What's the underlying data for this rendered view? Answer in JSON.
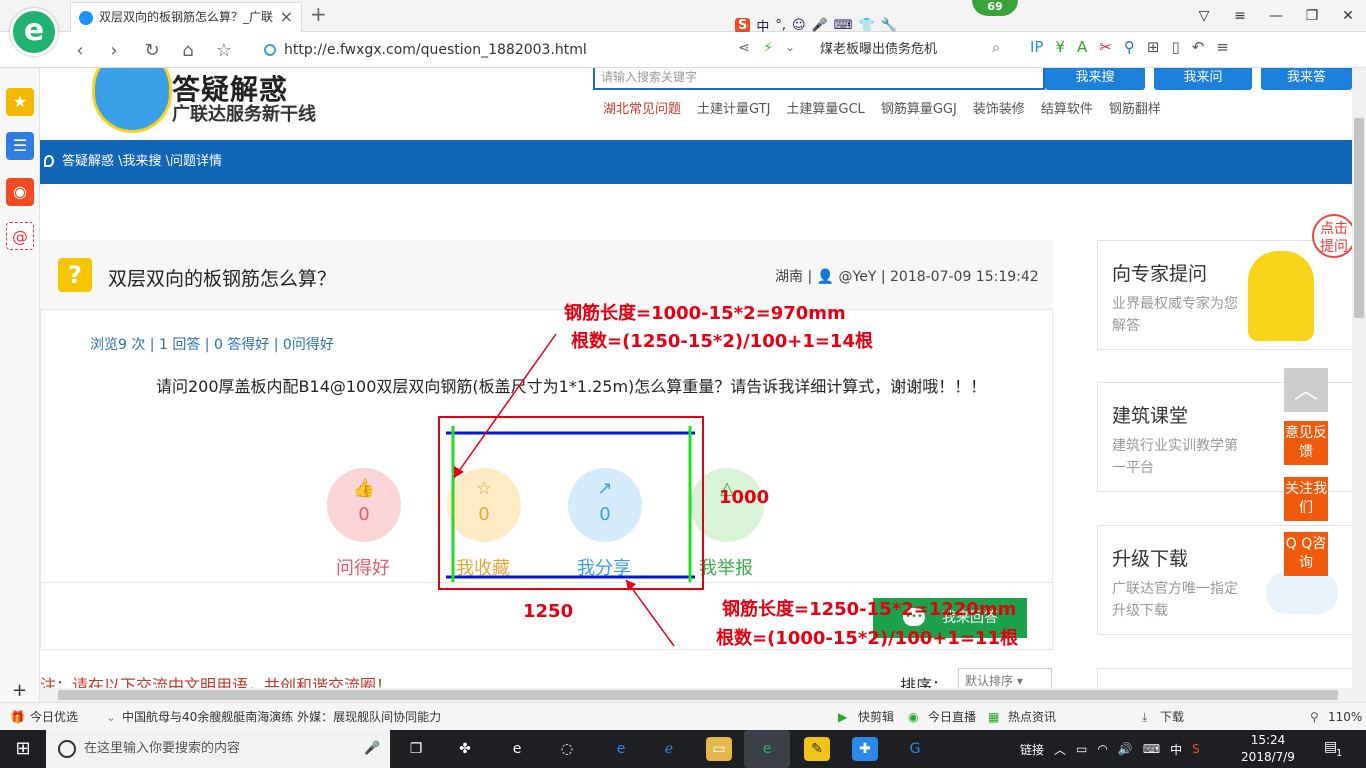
{
  "browser": {
    "logo_glyph": "e",
    "tab_title": "双层双向的板钢筋怎么算？_广联",
    "tab_close": "×",
    "new_tab": "+",
    "url": "http://e.fwxgx.com/question_1882003.html",
    "news_search": "煤老板曝出债务危机",
    "ime_label": "中",
    "ime_logo": "S",
    "badge": "69"
  },
  "sidebar": {
    "add": "+"
  },
  "site": {
    "title": "答疑解惑",
    "slogan": "广联达服务新干线",
    "search_placeholder": "请输入搜索关键字",
    "btn_search": "我来搜",
    "btn_ask": "我来问",
    "btn_answer": "我来答",
    "categories": [
      "湖北常见问题",
      "土建计量GTJ",
      "土建算量GCL",
      "钢筋算量GGJ",
      "装饰装修",
      "结算软件",
      "钢筋翻样"
    ]
  },
  "breadcrumb": "答疑解惑 \\我来搜 \\问题详情",
  "question": {
    "icon": "?",
    "title": "双层双向的板钢筋怎么算？",
    "meta_region": "湖南",
    "meta_user": "@YeY",
    "meta_time": "2018-07-09 15:19:42",
    "stats": "浏览9 次 | 1 回答 | 0 答得好 | 0问得好",
    "body": "请问200厚盖板内配B14@100双层双向钢筋(板盖尺寸为1*1.25m)怎么算重量？请告诉我详细计算式，谢谢哦！！！"
  },
  "actions": [
    {
      "label": "问得好",
      "count": "0",
      "glyph": "👍"
    },
    {
      "label": "我收藏",
      "count": "0",
      "glyph": "☆"
    },
    {
      "label": "我分享",
      "count": "0",
      "glyph": "↗"
    },
    {
      "label": "我举报",
      "count": "",
      "glyph": "△"
    }
  ],
  "answer_button": "我来回答",
  "notice": "注：请在以下交流中文明用语，共创和谐交流圈！",
  "sort": {
    "label": "排序：",
    "value": "默认排序"
  },
  "right_cards": [
    {
      "title": "向专家提问",
      "desc": "业界最权威专家为您解答"
    },
    {
      "title": "建筑课堂",
      "desc": "建筑行业实训教学第一平台"
    },
    {
      "title": "升级下载",
      "desc": "广联达官方唯一指定升级下载"
    }
  ],
  "float_buttons": [
    "意见反馈",
    "关注我们",
    "Q Q咨询"
  ],
  "float_bubble": "点击提问",
  "annotations": {
    "top_line1": "钢筋长度=1000-15*2=970mm",
    "top_line2": "根数=(1250-15*2)/100+1=14根",
    "dim_1000": "1000",
    "dim_1250": "1250",
    "bottom_line1": "钢筋长度=1250-15*2=1220mm",
    "bottom_line2": "根数=(1000-15*2)/100+1=11根"
  },
  "status_bar": {
    "left_label": "今日优选",
    "news": "中国航母与40余艘舰艇南海演练 外媒：展现舰队间协同能力",
    "items": [
      "快剪辑",
      "今日直播",
      "热点资讯"
    ],
    "download": "下载",
    "zoom": "110%"
  },
  "taskbar": {
    "search_placeholder": "在这里输入你要搜索的内容",
    "tray_link": "链接",
    "tray_ime": "中",
    "time": "15:24",
    "date": "2018/7/9",
    "notify_count": "1"
  },
  "colors": {
    "accent": "#1266b7",
    "annotation": "#e60012",
    "rebar_blue": "#0018d6",
    "rebar_green": "#22dd22"
  }
}
